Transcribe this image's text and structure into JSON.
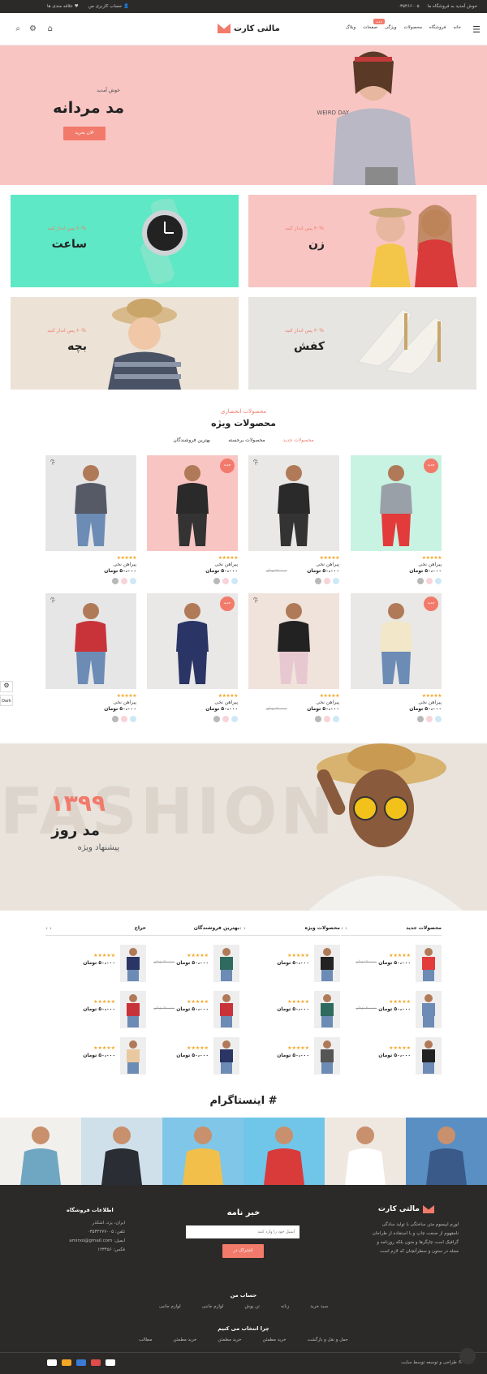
{
  "topbar": {
    "welcome": "خوش آمدید به فروشگاه ما",
    "phone": "۰۳۵۴۶۶۰۰۵",
    "account": "حساب کاربری من",
    "wishlist": "علاقه مندی ها"
  },
  "header": {
    "logo": "مالتی کارت",
    "nav": [
      "خانه",
      "فروشگاه",
      "محصولات",
      "ویژگی",
      "صفحات",
      "وبلاگ"
    ],
    "nav_badge": "جدید"
  },
  "hero": {
    "subtitle": "خوش آمدید",
    "title": "مد مردانه",
    "button": "الان بخرید",
    "shirt_text": "WEIRD DAY"
  },
  "banners": [
    {
      "offer": "۳۰% پس انداز کنید",
      "title": "زن"
    },
    {
      "offer": "۶۰% پس انداز کنید",
      "title": "ساعت"
    },
    {
      "offer": "۳۰% پس انداز کنید",
      "title": "کفش"
    },
    {
      "offer": "۶۰% پس انداز کنید",
      "title": "بچه"
    }
  ],
  "featured": {
    "subtitle": "محصولات انحصاری",
    "title": "محصولات ویژه",
    "tabs": [
      "محصولات جدید",
      "محصولات برجسته",
      "بهترین فروشندگان"
    ],
    "new_label": "جدید",
    "hot_label": "داغ",
    "product_name": "پیراهن نخی",
    "price": "۵۰،۰۰۰ تومان",
    "old_price": "۷۰،۰۰۰ تومان",
    "stars": "★★★★★"
  },
  "fashion": {
    "bg_text": "FASHION",
    "year": "۱۳۹۹",
    "title": "مد روز",
    "subtitle": "پیشنهاد ویژه"
  },
  "lists": [
    {
      "title": "محصولات جدید"
    },
    {
      "title": "محصولات ویژه"
    },
    {
      "title": "بهترین فروشندگان"
    },
    {
      "title": "حراج"
    }
  ],
  "instagram": {
    "title": "# اینستاگرام"
  },
  "footer": {
    "logo": "مالتی کارت",
    "about": [
      "لورم ایپسوم متن ساختگی با تولید سادگی",
      "نامفهوم از صنعت چاپ و با استفاده از طراحان",
      "گرافیک است چاپگرها و متون بلکه روزنامه و",
      "مجله در ستون و سطرآنچنان که لازم است"
    ],
    "newsletter_title": "خبر نامه",
    "email_placeholder": "ایمیل خود را وارد کنید",
    "subscribe": "اشتراک در",
    "info_title": "اطلاعات فروشگاه",
    "info": [
      "ایران، یزد، اشکذر",
      "تلفن: ۰۳۵۳۲۲۷۷۰۰۵",
      "ایمیل: amirxo@gmail.com",
      "فکس: ۱۲۳۴۵۶"
    ],
    "account_title": "حساب من",
    "account_links": [
      "سبد خرید",
      "زنانه",
      "تن پوش",
      "لوازم جانبی",
      "لوازم جانبی"
    ],
    "why_title": "چرا انتخاب می کنیم",
    "why_links": [
      "حمل و نقل و بازگشت",
      "خرید مطمئن",
      "خرید مطمئن",
      "خرید مطمئن",
      "مطالب"
    ],
    "copyright": "© طراحی و توسعه توسط سایت"
  },
  "side": {
    "dark": "Dark"
  },
  "colors": {
    "accent": "#f27a6b",
    "hero_bg": "#f8c5c3",
    "footer_bg": "#2b2a29",
    "mint": "#5ee8c5"
  }
}
